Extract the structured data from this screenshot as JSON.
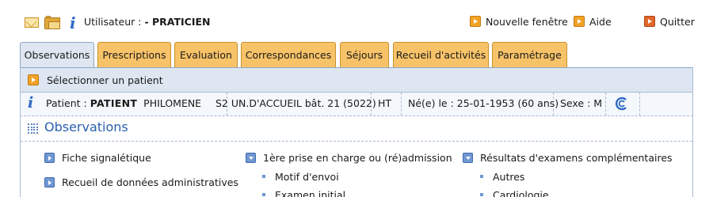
{
  "header": {
    "user_label": "Utilisateur : ",
    "user_name": "- PRATICIEN",
    "links": [
      {
        "label": "Nouvelle fenêtre",
        "icon": "orange-arrow-button"
      },
      {
        "label": "Aide",
        "icon": "orange-arrow-button"
      },
      {
        "label": "Quitter",
        "icon": "red-arrow-button"
      }
    ]
  },
  "tabs": [
    {
      "label": "Observations",
      "active": true
    },
    {
      "label": "Prescriptions"
    },
    {
      "label": "Evaluation"
    },
    {
      "label": "Correspondances"
    },
    {
      "label": "Séjours"
    },
    {
      "label": "Recueil d'activités"
    },
    {
      "label": "Paramétrage"
    }
  ],
  "patient": {
    "select_label": "Sélectionner un patient",
    "label": "Patient : ",
    "last_name": "PATIENT",
    "first_name": "PHILOMENE",
    "unit": "S2 UN.D'ACCUEIL bât. 21 (5022)",
    "code": "HT",
    "birth": "Né(e) le : 25-01-1953 (60 ans)",
    "sex": "Sexe : M"
  },
  "observations": {
    "title": "Observations",
    "col1": [
      "Fiche signalétique",
      "Recueil de données administratives"
    ],
    "col2": {
      "heading": "1ère prise en charge ou (ré)admission",
      "items": [
        "Motif d'envoi",
        "Examen initial"
      ]
    },
    "col3": {
      "heading": "Résultats d'examens complémentaires",
      "items": [
        "Autres",
        "Cardiologie"
      ]
    }
  },
  "colors": {
    "tab_bg": "#f8c368",
    "active_tab_bg": "#dde6f1",
    "accent_blue": "#2a5fb0",
    "orange_button": "#f2a227"
  }
}
